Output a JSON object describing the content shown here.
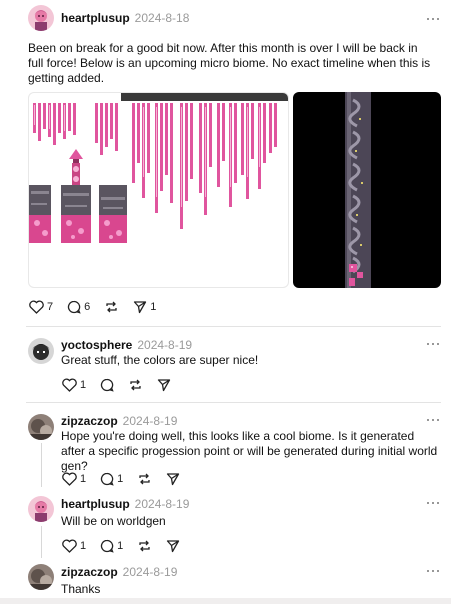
{
  "post": {
    "username": "heartplusup",
    "date": "2024-8-18",
    "text": "Been on break for a good bit now. After this month is over I will be back in full force! Below is an upcoming micro biome. No exact timeline when this is getting added.",
    "likes": "7",
    "comments": "6",
    "shares": "1"
  },
  "replies": [
    {
      "username": "yoctosphere",
      "date": "2024-8-19",
      "text": "Great stuff, the colors are super nice!",
      "likes": "1"
    },
    {
      "username": "zipzaczop",
      "date": "2024-8-19",
      "text": "Hope you're doing well, this looks like a cool biome. Is it generated after a specific progession point or will be generated during initial world gen?",
      "likes": "1",
      "comments": "1"
    },
    {
      "username": "heartplusup",
      "date": "2024-8-19",
      "text": "Will be on worldgen",
      "likes": "1",
      "comments": "1"
    },
    {
      "username": "zipzaczop",
      "date": "2024-8-19",
      "text": "Thanks"
    }
  ],
  "icons": {
    "like": "heart-icon",
    "comment": "comment-icon",
    "repost": "repost-icon",
    "share": "send-icon",
    "more": "more-icon"
  },
  "colors": {
    "crystal_pink": "#e0559e",
    "crystal_light": "#f6b3d6",
    "stone": "#5a5560",
    "date_gray": "#9a9a9a"
  }
}
